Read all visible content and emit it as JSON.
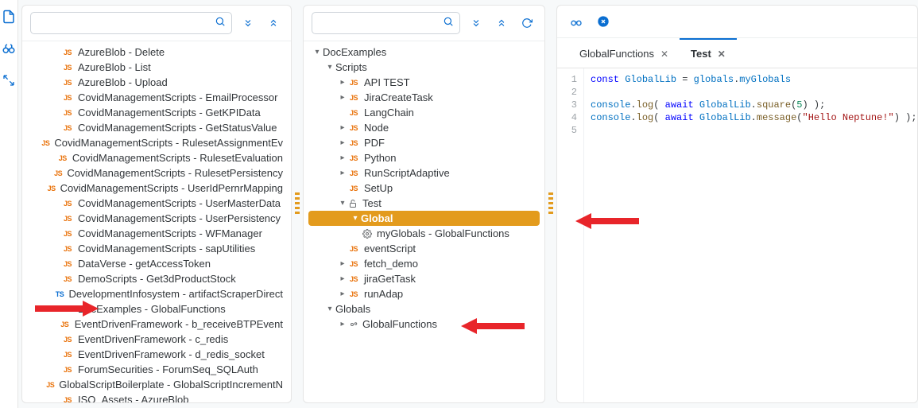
{
  "rail": {
    "items": [
      "file-icon",
      "binoculars-icon",
      "expand-icon"
    ]
  },
  "panelLeft": {
    "search": {
      "placeholder": ""
    },
    "items": [
      {
        "badge": "JS",
        "label": "AzureBlob - Delete"
      },
      {
        "badge": "JS",
        "label": "AzureBlob - List"
      },
      {
        "badge": "JS",
        "label": "AzureBlob - Upload"
      },
      {
        "badge": "JS",
        "label": "CovidManagementScripts - EmailProcessor"
      },
      {
        "badge": "JS",
        "label": "CovidManagementScripts - GetKPIData"
      },
      {
        "badge": "JS",
        "label": "CovidManagementScripts - GetStatusValue"
      },
      {
        "badge": "JS",
        "label": "CovidManagementScripts - RulesetAssignmentEv"
      },
      {
        "badge": "JS",
        "label": "CovidManagementScripts - RulesetEvaluation"
      },
      {
        "badge": "JS",
        "label": "CovidManagementScripts - RulesetPersistency"
      },
      {
        "badge": "JS",
        "label": "CovidManagementScripts - UserIdPernrMapping"
      },
      {
        "badge": "JS",
        "label": "CovidManagementScripts - UserMasterData"
      },
      {
        "badge": "JS",
        "label": "CovidManagementScripts - UserPersistency"
      },
      {
        "badge": "JS",
        "label": "CovidManagementScripts - WFManager"
      },
      {
        "badge": "JS",
        "label": "CovidManagementScripts - sapUtilities"
      },
      {
        "badge": "JS",
        "label": "DataVerse - getAccessToken"
      },
      {
        "badge": "JS",
        "label": "DemoScripts - Get3dProductStock"
      },
      {
        "badge": "TS",
        "label": "DevelopmentInfosystem - artifactScraperDirect"
      },
      {
        "badge": "JS",
        "label": "DocExamples - GlobalFunctions"
      },
      {
        "badge": "JS",
        "label": "EventDrivenFramework - b_receiveBTPEvent"
      },
      {
        "badge": "JS",
        "label": "EventDrivenFramework - c_redis"
      },
      {
        "badge": "JS",
        "label": "EventDrivenFramework - d_redis_socket"
      },
      {
        "badge": "JS",
        "label": "ForumSecurities - ForumSeq_SQLAuth"
      },
      {
        "badge": "JS",
        "label": "GlobalScriptBoilerplate - GlobalScriptIncrementN"
      },
      {
        "badge": "JS",
        "label": "ISO_Assets - AzureBlob"
      }
    ]
  },
  "panelMid": {
    "search": {
      "placeholder": ""
    },
    "tree": {
      "root": "DocExamples",
      "scriptsLabel": "Scripts",
      "globalsLabel": "Globals",
      "scripts": [
        {
          "chev": "right",
          "badge": "JS",
          "label": "API TEST"
        },
        {
          "chev": "right",
          "badge": "JS",
          "label": "JiraCreateTask"
        },
        {
          "chev": "none",
          "badge": "JS",
          "label": "LangChain"
        },
        {
          "chev": "right",
          "badge": "JS",
          "label": "Node"
        },
        {
          "chev": "right",
          "badge": "JS",
          "label": "PDF"
        },
        {
          "chev": "right",
          "badge": "JS",
          "label": "Python"
        },
        {
          "chev": "right",
          "badge": "JS",
          "label": "RunScriptAdaptive"
        },
        {
          "chev": "none",
          "badge": "JS",
          "label": "SetUp"
        }
      ],
      "testLabel": "Test",
      "testChildren": {
        "globalLabel": "Global",
        "globalChild": "myGlobals - GlobalFunctions"
      },
      "afterTest": [
        {
          "chev": "none",
          "badge": "JS",
          "label": "eventScript"
        },
        {
          "chev": "right",
          "badge": "JS",
          "label": "fetch_demo"
        },
        {
          "chev": "right",
          "badge": "JS",
          "label": "jiraGetTask"
        },
        {
          "chev": "right",
          "badge": "JS",
          "label": "runAdap"
        }
      ],
      "globalsChild": "GlobalFunctions"
    }
  },
  "panelRight": {
    "tabs": [
      {
        "label": "GlobalFunctions",
        "active": false
      },
      {
        "label": "Test",
        "active": true
      }
    ],
    "code": {
      "lines": [
        "1",
        "2",
        "3",
        "4",
        "5"
      ],
      "l1": {
        "kw": "const",
        "var": "GlobalLib",
        "eq": "=",
        "obj": "globals",
        "dot": ".",
        "prop": "myGlobals"
      },
      "l3": {
        "obj": "console",
        "fn": "log",
        "kw": "await",
        "var": "GlobalLib",
        "m": "square",
        "num": "5"
      },
      "l4": {
        "obj": "console",
        "fn": "log",
        "kw": "await",
        "var": "GlobalLib",
        "m": "message",
        "str": "\"Hello Neptune!\""
      }
    }
  },
  "glyphs": {
    "js": "JS",
    "ts": "TS"
  }
}
